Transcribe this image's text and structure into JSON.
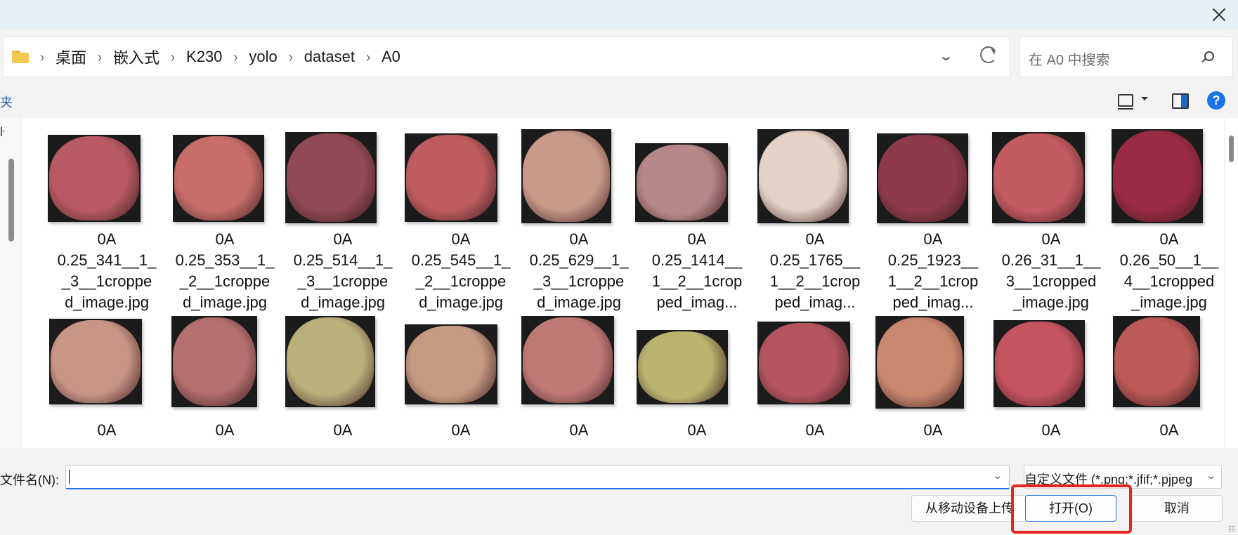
{
  "breadcrumb": [
    "桌面",
    "嵌入式",
    "K230",
    "yolo",
    "dataset",
    "A0"
  ],
  "search": {
    "placeholder": "在 A0 中搜索"
  },
  "toolbar": {
    "left_fragment": "夹",
    "help": "?"
  },
  "leftpane": {
    "fragment": "ŀ"
  },
  "files_row1": [
    {
      "name": "0A\n0.25_341__1_\n_3__1croppe\nd_image.jpg",
      "color": "#b85a63"
    },
    {
      "name": "0A\n0.25_353__1_\n_2__1croppe\nd_image.jpg",
      "color": "#c76e6a"
    },
    {
      "name": "0A\n0.25_514__1_\n_3__1croppe\nd_image.jpg",
      "color": "#8f4a55"
    },
    {
      "name": "0A\n0.25_545__1_\n_2__1croppe\nd_image.jpg",
      "color": "#bd5c5f"
    },
    {
      "name": "0A\n0.25_629__1_\n_3__1croppe\nd_image.jpg",
      "color": "#c99a8a"
    },
    {
      "name": "0A\n0.25_1414__\n1__2__1crop\nped_imag...",
      "color": "#b78888"
    },
    {
      "name": "0A\n0.25_1765__\n1__2__1crop\nped_imag...",
      "color": "#e4d2c6"
    },
    {
      "name": "0A\n0.25_1923__\n1__2__1crop\nped_imag...",
      "color": "#8e3a4a"
    },
    {
      "name": "0A\n0.26_31__1__\n3__1cropped\n_image.jpg",
      "color": "#c45b62"
    },
    {
      "name": "0A\n0.26_50__1__\n4__1cropped\n_image.jpg",
      "color": "#9b2b45"
    }
  ],
  "files_row2": [
    {
      "name": "0A",
      "color": "#c99587"
    },
    {
      "name": "0A",
      "color": "#b3706e"
    },
    {
      "name": "0A",
      "color": "#b9b07b"
    },
    {
      "name": "0A",
      "color": "#c79b83"
    },
    {
      "name": "0A",
      "color": "#c07a76"
    },
    {
      "name": "0A",
      "color": "#b8b46f"
    },
    {
      "name": "0A",
      "color": "#b4565f"
    },
    {
      "name": "0A",
      "color": "#c9896f"
    },
    {
      "name": "0A",
      "color": "#c4545f"
    },
    {
      "name": "0A",
      "color": "#bb5a57"
    }
  ],
  "filename": {
    "label": "文件名(N):",
    "value": ""
  },
  "filter": {
    "label": "自定义文件 (*.png;*.jfif;*.pjpeg"
  },
  "buttons": {
    "upload": "从移动设备上传",
    "open": "打开(O)",
    "cancel": "取消"
  }
}
